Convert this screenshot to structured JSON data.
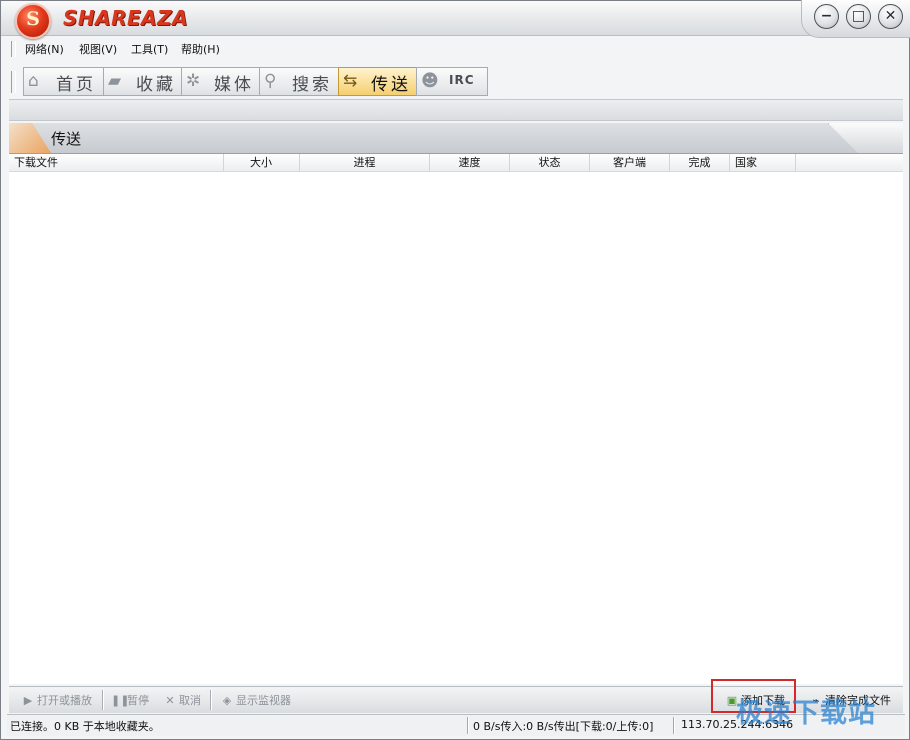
{
  "app": {
    "title": "SHAREAZA"
  },
  "window_controls": {
    "minimize": "−",
    "maximize": "□",
    "close": "✕"
  },
  "menu": [
    "网络(N)",
    "视图(V)",
    "工具(T)",
    "帮助(H)"
  ],
  "nav": [
    {
      "label": "首页",
      "icon": "home-icon"
    },
    {
      "label": "收藏",
      "icon": "folder-icon"
    },
    {
      "label": "媒体",
      "icon": "film-reel-icon"
    },
    {
      "label": "搜索",
      "icon": "magnifier-icon"
    },
    {
      "label": "传送",
      "icon": "transfer-icon",
      "active": true
    },
    {
      "label": "IRC",
      "icon": "chat-users-icon"
    }
  ],
  "panel": {
    "title": "传送"
  },
  "table": {
    "columns": [
      "下载文件",
      "大小",
      "进程",
      "速度",
      "状态",
      "客户端",
      "完成",
      "国家"
    ],
    "rows": []
  },
  "bottom_toolbar": {
    "open_play": "打开或播放",
    "pause": "暂停",
    "cancel": "取消",
    "show_monitor": "显示监视器",
    "add_download": "添加下载",
    "clear_completed": "清除完成文件"
  },
  "status": {
    "connection": "已连接。0 KB 于本地收藏夹。",
    "bandwidth": "0 B/s传入:0 B/s传出[下载:0/上传:0]",
    "address": "113.70.25.244:6346"
  },
  "watermark": "极速下载站",
  "colors": {
    "brand_red": "#d8371d",
    "active_tab": "#f5cf6e",
    "highlight_box": "#d62828",
    "watermark": "#2280d1"
  }
}
